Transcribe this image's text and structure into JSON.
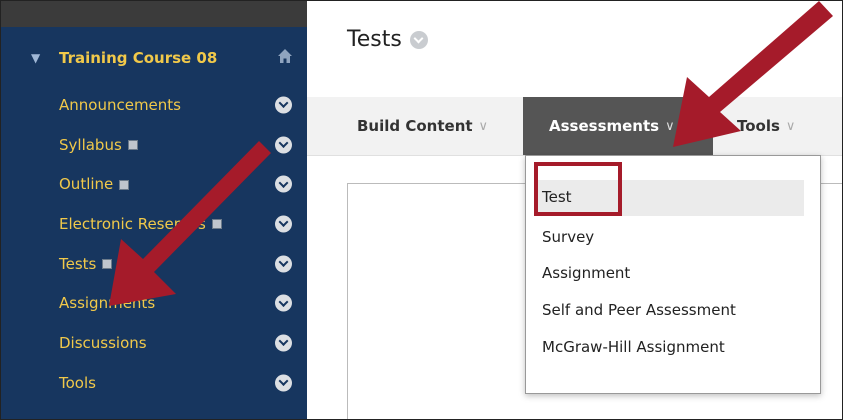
{
  "sidebar": {
    "course_title": "Training Course 08",
    "items": [
      {
        "label": "Announcements",
        "has_doc_icon": false
      },
      {
        "label": "Syllabus",
        "has_doc_icon": true
      },
      {
        "label": "Outline",
        "has_doc_icon": true
      },
      {
        "label": "Electronic Reserves",
        "has_doc_icon": true
      },
      {
        "label": "Tests",
        "has_doc_icon": true
      },
      {
        "label": "Assignments",
        "has_doc_icon": false
      },
      {
        "label": "Discussions",
        "has_doc_icon": false
      },
      {
        "label": "Tools",
        "has_doc_icon": false
      }
    ]
  },
  "main": {
    "page_title": "Tests",
    "toolbar": {
      "build_content": "Build Content",
      "assessments": "Assessments",
      "tools": "Tools"
    },
    "dropdown": [
      "Test",
      "Survey",
      "Assignment",
      "Self and Peer Assessment",
      "McGraw-Hill Assignment"
    ]
  },
  "colors": {
    "sidebar_bg": "#17365f",
    "sidebar_text": "#f1c94a",
    "arrow_red": "#a51b2a",
    "active_tab_bg": "#555555"
  }
}
